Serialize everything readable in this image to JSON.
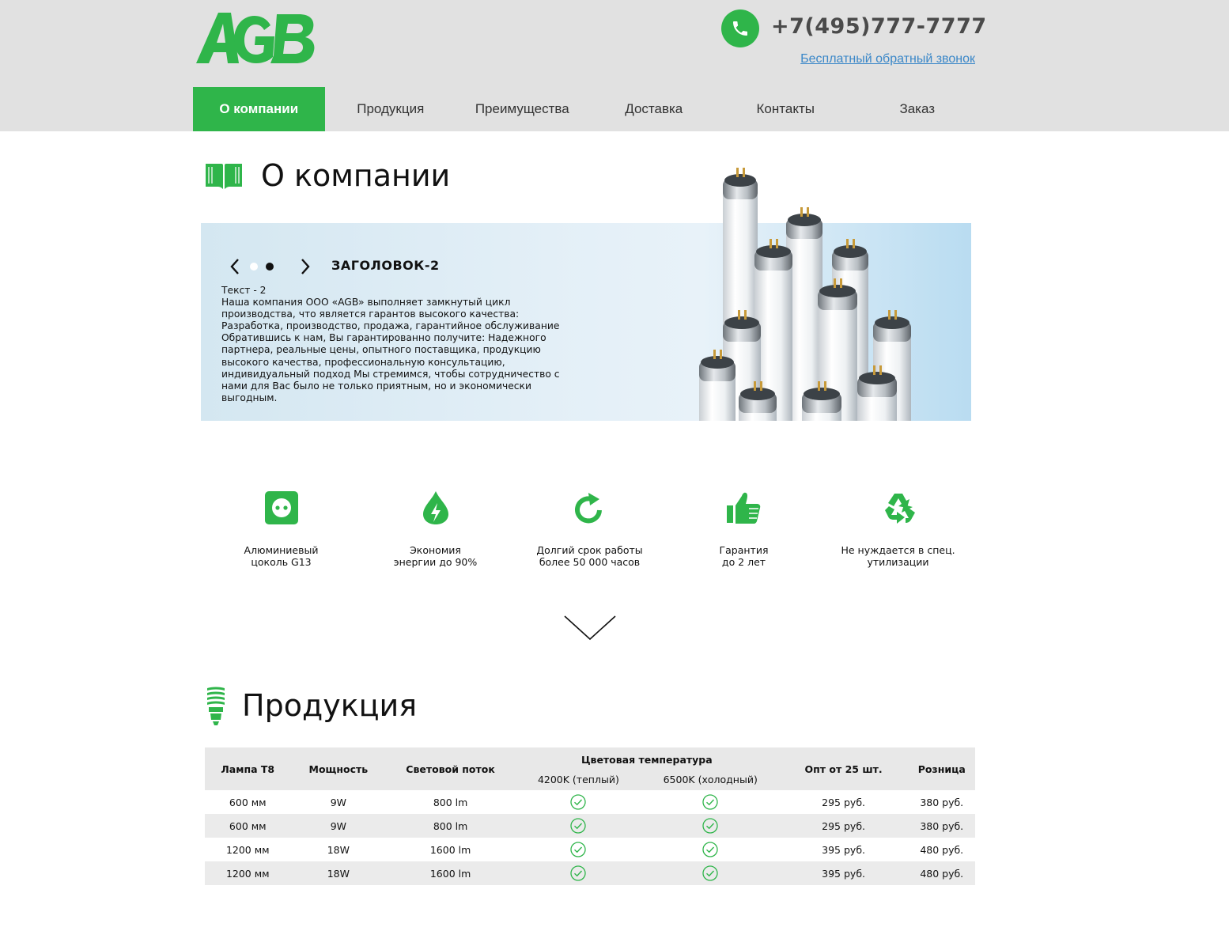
{
  "header": {
    "logo_text": "AGB",
    "phone": "+7(495)777-7777",
    "callback_link": "Бесплатный обратный звонок",
    "icons": [
      "phone-icon"
    ]
  },
  "nav": {
    "items": [
      {
        "label": "О компании",
        "active": true
      },
      {
        "label": "Продукция",
        "active": false
      },
      {
        "label": "Преимущества",
        "active": false
      },
      {
        "label": "Доставка",
        "active": false
      },
      {
        "label": "Контакты",
        "active": false
      },
      {
        "label": "Заказ",
        "active": false
      }
    ]
  },
  "about": {
    "title": "О компании",
    "icon": "book-icon",
    "slider": {
      "heading": "ЗАГОЛОВОК-2",
      "text_title": "Текст - 2",
      "text_body": "Наша компания ООО «AGB» выполняет замкнутый цикл производства, что является гарантов высокого качества: Разработка, производство, продажа, гарантийное обслуживание Обратившись к нам, Вы гарантированно получите: Надежного партнера, реальные цены, опытного поставщика, продукцию высокого качества, профессиональную консультацию, индивидуальный подход Мы стремимся, чтобы сотрудничество с нами для Вас было не только приятным, но и экономически выгодным.",
      "slide_count": 2,
      "active_slide": 2
    }
  },
  "features": [
    {
      "icon": "socket-icon",
      "label": "Алюминиевый\nцоколь G13"
    },
    {
      "icon": "energy-drop-icon",
      "label": "Экономия\nэнергии до 90%"
    },
    {
      "icon": "refresh-icon",
      "label": "Долгий срок работы\nболее 50 000 часов"
    },
    {
      "icon": "thumbs-up-icon",
      "label": "Гарантия\nдо 2 лет"
    },
    {
      "icon": "recycle-icon",
      "label": "Не нуждается в спец.\nутилизации"
    }
  ],
  "products": {
    "title": "Продукция",
    "icon": "bulb-icon",
    "table": {
      "headers": {
        "lamp": "Лампа Т8",
        "power": "Мощность",
        "flux": "Световой поток",
        "color_temp": "Цветовая температура",
        "warm": "4200K (теплый)",
        "cold": "6500K (холодный)",
        "wholesale": "Опт от 25 шт.",
        "retail": "Розница"
      },
      "rows": [
        {
          "lamp": "600 мм",
          "power": "9W",
          "flux": "800 lm",
          "warm": true,
          "cold": true,
          "wholesale": "295 руб.",
          "retail": "380 руб."
        },
        {
          "lamp": "600 мм",
          "power": "9W",
          "flux": "800 lm",
          "warm": true,
          "cold": true,
          "wholesale": "295 руб.",
          "retail": "380 руб."
        },
        {
          "lamp": "1200 мм",
          "power": "18W",
          "flux": "1600 lm",
          "warm": true,
          "cold": true,
          "wholesale": "395 руб.",
          "retail": "480 руб."
        },
        {
          "lamp": "1200 мм",
          "power": "18W",
          "flux": "1600 lm",
          "warm": true,
          "cold": true,
          "wholesale": "395 руб.",
          "retail": "480 руб."
        }
      ]
    }
  },
  "colors": {
    "brand_green": "#2fb54a",
    "header_bg": "#e1e1e1",
    "link_blue": "#3a87c8"
  }
}
